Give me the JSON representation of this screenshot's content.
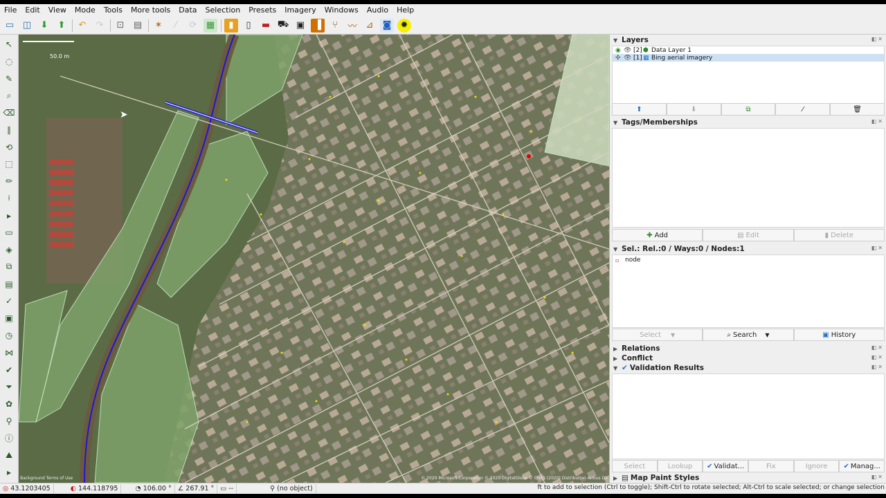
{
  "menu": [
    "File",
    "Edit",
    "View",
    "Mode",
    "Tools",
    "More tools",
    "Data",
    "Selection",
    "Presets",
    "Imagery",
    "Windows",
    "Audio",
    "Help"
  ],
  "map": {
    "scale_label": "50.0 m",
    "attribution_left": "Background Terms of Use",
    "attribution_right": "© 2020 Microsoft Corporation © 2020 DigitalGlobe © CNES (2020) Distribution Airbus DS"
  },
  "layers": {
    "title": "Layers",
    "items": [
      {
        "index": "[2]",
        "name": "Data Layer 1",
        "selected": false
      },
      {
        "index": "[1]",
        "name": "Bing aerial imagery",
        "selected": true
      }
    ],
    "buttons": [
      "up-arrow-icon",
      "down-arrow-icon",
      "merge-icon",
      "hide-icon",
      "trash-icon"
    ]
  },
  "tags": {
    "title": "Tags/Memberships",
    "add_label": "Add",
    "edit_label": "Edit",
    "delete_label": "Delete"
  },
  "selection": {
    "title": "Sel.: Rel.:0 / Ways:0 / Nodes:1",
    "item": "node",
    "select_label": "Select",
    "search_label": "Search",
    "history_label": "History"
  },
  "relations": {
    "title": "Relations"
  },
  "conflict": {
    "title": "Conflict"
  },
  "validation": {
    "title": "Validation Results",
    "select_label": "Select",
    "lookup_label": "Lookup",
    "validate_label": "Validat...",
    "fix_label": "Fix",
    "ignore_label": "Ignore",
    "manage_label": "Manag..."
  },
  "map_paint": {
    "title": "Map Paint Styles"
  },
  "status": {
    "lat": "43.1203405",
    "lon": "144.118795",
    "heading": "106.00 °",
    "angle": "267.91 °",
    "length": "--",
    "object": "(no object)",
    "help": "ft to add to selection (Ctrl to toggle); Shift-Ctrl to rotate selected; Alt-Ctrl to scale selected; or change selection"
  }
}
